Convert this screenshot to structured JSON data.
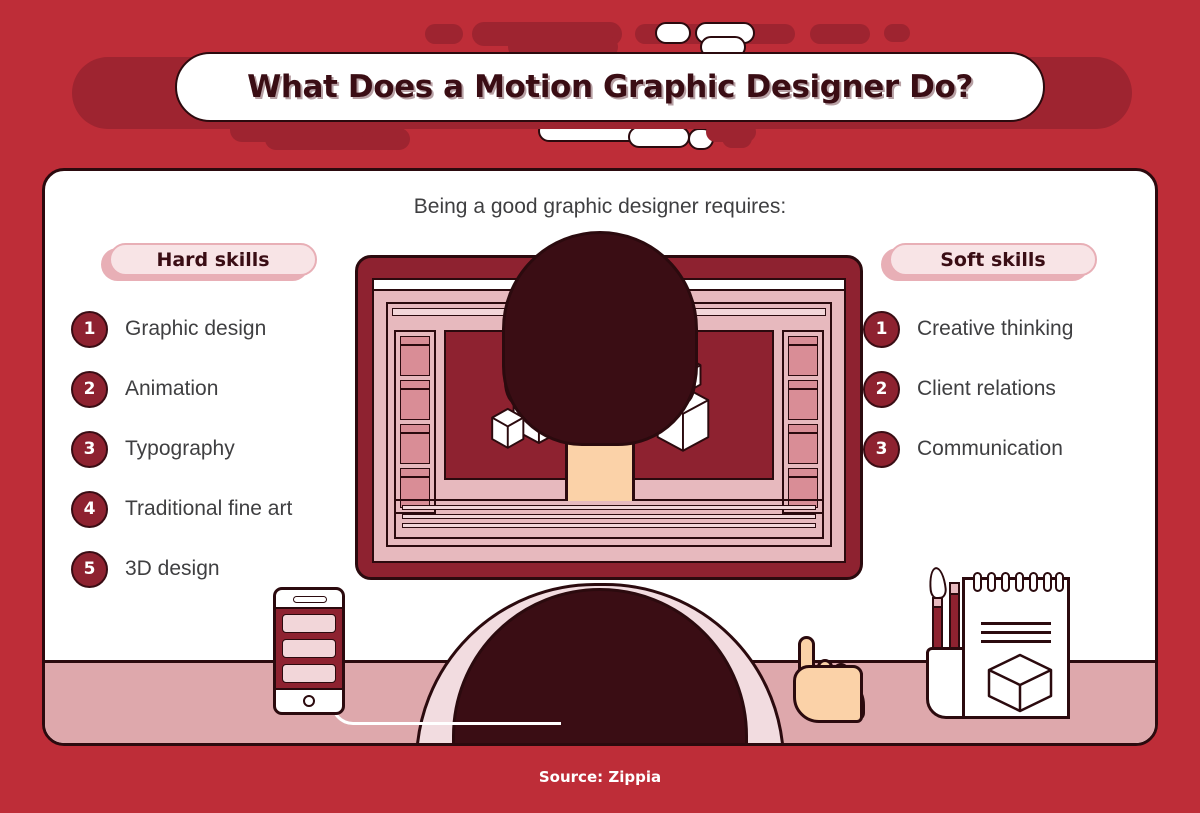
{
  "header": {
    "title": "What Does a Motion Graphic Designer Do?"
  },
  "card": {
    "subtitle": "Being a good graphic designer requires:"
  },
  "hard_skills": {
    "heading": "Hard skills",
    "items": [
      {
        "num": "1",
        "label": "Graphic design"
      },
      {
        "num": "2",
        "label": "Animation"
      },
      {
        "num": "3",
        "label": "Typography"
      },
      {
        "num": "4",
        "label": "Traditional fine art"
      },
      {
        "num": "5",
        "label": "3D design"
      }
    ]
  },
  "soft_skills": {
    "heading": "Soft skills",
    "items": [
      {
        "num": "1",
        "label": "Creative thinking"
      },
      {
        "num": "2",
        "label": "Client relations"
      },
      {
        "num": "3",
        "label": "Communication"
      }
    ]
  },
  "illustration": {
    "monitor": "designer-monitor",
    "canvas_objects": "3d-cubes",
    "desk_items": [
      "smartphone",
      "pen-cup",
      "notepad",
      "mouse"
    ]
  },
  "footer": {
    "source": "Source: Zippia"
  },
  "colors": {
    "background_red": "#BE2D38",
    "dark_red": "#8E2230",
    "deep_maroon": "#3A0D14",
    "outline": "#2B0A0E",
    "desk_pink": "#DEA8AC",
    "pill_pink": "#F8E4E6",
    "pill_border": "#E8AFB6",
    "screen_pink": "#E7B9BE",
    "skin": "#FBD2A8",
    "shirt": "#F2DCE0",
    "text_gray": "#3F3F41",
    "white": "#FFFFFF"
  }
}
